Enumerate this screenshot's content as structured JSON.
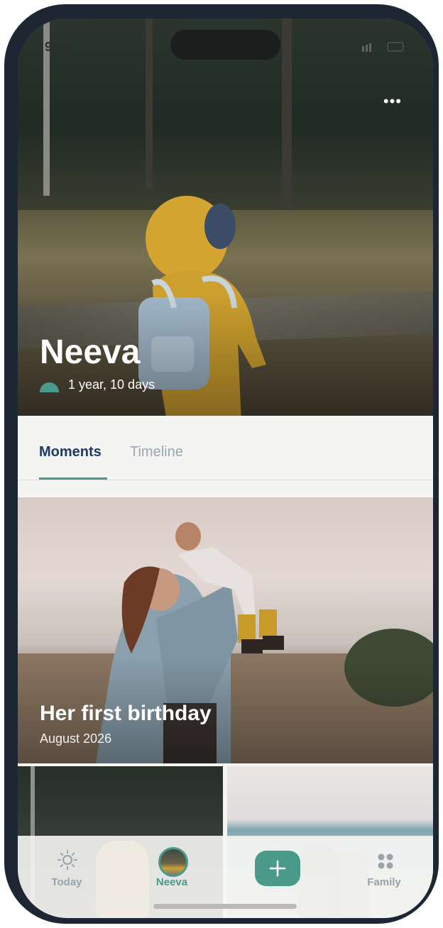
{
  "status_bar": {
    "time": "9:41"
  },
  "header": {
    "menu_icon": "more-horizontal-icon"
  },
  "profile": {
    "name": "Neeva",
    "age": "1 year, 10 days",
    "age_icon": "half-circle-icon"
  },
  "tabs": [
    {
      "label": "Moments",
      "active": true
    },
    {
      "label": "Timeline",
      "active": false
    }
  ],
  "feature_moment": {
    "title": "Her first birthday",
    "date": "August 2026"
  },
  "bottom_nav": [
    {
      "label": "Today",
      "icon": "sun-icon",
      "active": false
    },
    {
      "label": "Neeva",
      "icon": "avatar",
      "active": true
    },
    {
      "label": "",
      "icon": "plus-icon",
      "active": false
    },
    {
      "label": "Family",
      "icon": "grid-dots-icon",
      "active": false
    }
  ],
  "colors": {
    "accent": "#4a9a8c",
    "active_tab_text": "#1e3a5f",
    "inactive_text": "#9aa3a8",
    "frame": "#1c2733"
  }
}
